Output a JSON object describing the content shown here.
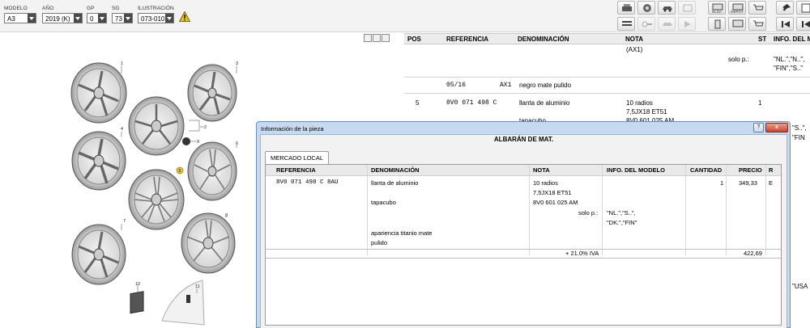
{
  "selectors": {
    "modelo": {
      "label": "MODELO",
      "value": "A3"
    },
    "anio": {
      "label": "AÑO",
      "value": "2019 (K)"
    },
    "gp": {
      "label": "GP",
      "value": "0"
    },
    "sg": {
      "label": "SG",
      "value": "73"
    },
    "ilustracion": {
      "label": "ILUSTRACIÓN",
      "value": "073-010"
    }
  },
  "toolbar": {
    "row1": [
      "printer-icon",
      "disk-icon",
      "car-icon",
      "book-icon",
      "monitor-icon",
      "monitor-icon",
      "cart-icon",
      "pin-icon",
      "print-preview-icon"
    ],
    "row1_caps": [
      "",
      "",
      "",
      "",
      "ELSA",
      "DEPOT",
      "",
      "",
      ""
    ],
    "row2_caps": [
      "",
      "",
      "",
      "",
      "",
      "",
      "",
      "",
      ""
    ]
  },
  "parts_table": {
    "headers": {
      "pos": "POS",
      "referencia": "REFERENCIA",
      "denominacion": "DENOMINACIÓN",
      "nota": "NOTA",
      "st": "ST",
      "info": "INFO. DEL M"
    },
    "nota_top": "(AX1)",
    "solo_p_label": "solo p.:",
    "solo_p_vals_1": "\"NL.\",\"N..\",",
    "solo_p_vals_2": "\"FIN\",\"S..\"",
    "row_a": {
      "ref": "05/16",
      "code": "AX1",
      "denom": "negro mate pulido"
    },
    "row_b": {
      "pos": "5",
      "ref": "8V0  071  498  C",
      "denom": "llanta de aluminio",
      "nota1": "10 radios",
      "nota2": "7,5JX18 ET51",
      "st": "1"
    },
    "row_c": {
      "denom": "tapacubo",
      "nota": "8V0 601 025 AM"
    },
    "right_snip_1": "\"S..\",",
    "right_snip_2": "\"FIN",
    "right_snip_3": "\"USA"
  },
  "illustration": {
    "callouts": [
      "1",
      "2",
      "3",
      "4",
      "5",
      "6",
      "7",
      "8",
      "9",
      "10",
      "11"
    ]
  },
  "dialog": {
    "title": "Información de la pieza",
    "help_label": "?",
    "close_label": "x",
    "heading": "ALBARÁN DE MAT.",
    "tab": "MERCADO LOCAL",
    "headers": {
      "referencia": "REFERENCIA",
      "denominacion": "DENOMINACIÓN",
      "nota": "NOTA",
      "info": "INFO. DEL MODELO",
      "cantidad": "CANTIDAD",
      "precio": "PRECIO",
      "r": "R"
    },
    "item": {
      "ref": "8V0  071  498  C   8AU",
      "denom": "llanta de aluminio",
      "nota1": "10 radios",
      "nota2": "7,5JX18 ET51",
      "cantidad": "1",
      "precio": "349,33",
      "r": "E"
    },
    "item2": {
      "denom": "tapacubo",
      "nota": "8V0 601 025 AM"
    },
    "solo_p": {
      "label": "solo p.:",
      "vals1": "\"NL.\",\"S..\",",
      "vals2": "\"DK.\",\"FIN\""
    },
    "extra1": "apariencia titanio mate",
    "extra2": "pulido",
    "iva": "+ 21.0% IVA",
    "total": "422,69"
  },
  "colors": {
    "dialog_frame": "#c6d9ee",
    "close_button": "#c6452c",
    "warning": "#f2c200"
  }
}
